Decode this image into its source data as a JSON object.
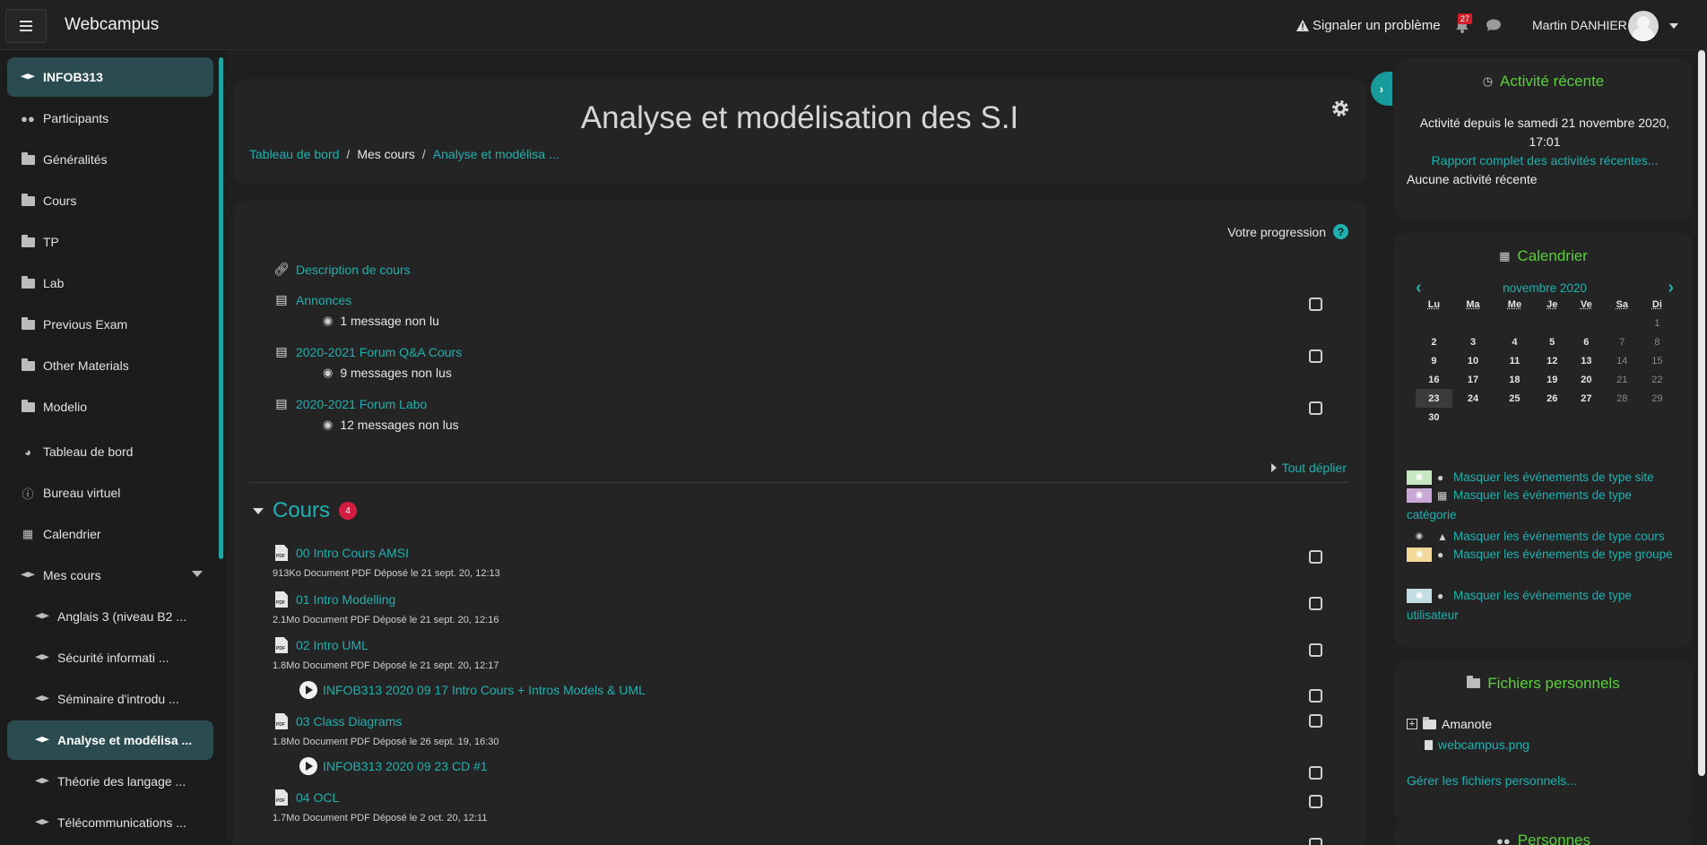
{
  "navbar": {
    "brand": "Webcampus",
    "report": "Signaler un problème",
    "notif_count": "27",
    "user_name": "Martin DANHIER"
  },
  "drawer": {
    "items": [
      {
        "label": "INFOB313",
        "icon": "graduation-cap-icon",
        "active": true
      },
      {
        "label": "Participants",
        "icon": "users-icon"
      },
      {
        "label": "Généralités",
        "icon": "folder-icon"
      },
      {
        "label": "Cours",
        "icon": "folder-icon"
      },
      {
        "label": "TP",
        "icon": "folder-icon"
      },
      {
        "label": "Lab",
        "icon": "folder-icon"
      },
      {
        "label": "Previous Exam",
        "icon": "folder-icon"
      },
      {
        "label": "Other Materials",
        "icon": "folder-icon"
      },
      {
        "label": "Modelio",
        "icon": "folder-icon"
      },
      {
        "label": "Tableau de bord",
        "icon": "dashboard-icon"
      },
      {
        "label": "Bureau virtuel",
        "icon": "info-icon"
      },
      {
        "label": "Calendrier",
        "icon": "calendar-icon"
      },
      {
        "label": "Mes cours",
        "icon": "graduation-cap-icon"
      },
      {
        "label": "Anglais 3 (niveau B2 ...",
        "icon": "graduation-cap-icon"
      },
      {
        "label": "Sécurité informati ...",
        "icon": "graduation-cap-icon"
      },
      {
        "label": "Séminaire d'introdu ...",
        "icon": "graduation-cap-icon"
      },
      {
        "label": "Analyse et modélisa ...",
        "icon": "graduation-cap-icon",
        "active": true
      },
      {
        "label": "Théorie des langage ...",
        "icon": "graduation-cap-icon"
      },
      {
        "label": "Télécommunications ...",
        "icon": "graduation-cap-icon"
      }
    ]
  },
  "header": {
    "title": "Analyse et modélisation des S.I",
    "breadcrumb": [
      "Tableau de bord",
      "Mes cours",
      "Analyse et modélisa ..."
    ]
  },
  "course": {
    "progress_label": "Votre progression",
    "progress_help": "?",
    "top_activities": [
      {
        "label": "Description de cours",
        "icon": "link-icon"
      },
      {
        "label": "Annonces",
        "icon": "forum-icon",
        "unread": "1 message non lu"
      },
      {
        "label": "2020-2021 Forum Q&A Cours",
        "icon": "forum-icon",
        "unread": "9 messages non lus"
      },
      {
        "label": "2020-2021 Forum Labo",
        "icon": "forum-icon",
        "unread": "12 messages non lus"
      }
    ],
    "expand_all": "Tout déplier",
    "section_title": "Cours",
    "section_count": "4",
    "section_activities": [
      {
        "label": "00 Intro Cours AMSI",
        "type": "pdf",
        "meta": "913Ko Document PDF Déposé le 21 sept. 20, 12:13"
      },
      {
        "label": "01 Intro Modelling",
        "type": "pdf",
        "meta": "2.1Mo Document PDF Déposé le 21 sept. 20, 12:16"
      },
      {
        "label": "02 Intro UML",
        "type": "pdf",
        "meta": "1.8Mo Document PDF Déposé le 21 sept. 20, 12:17"
      },
      {
        "label": "INFOB313 2020 09 17 Intro Cours + Intros Models & UML",
        "type": "video"
      },
      {
        "label": "03 Class Diagrams",
        "type": "pdf",
        "meta": "1.8Mo Document PDF Déposé le 26 sept. 19, 16:30"
      },
      {
        "label": "INFOB313 2020 09 23 CD #1",
        "type": "video"
      },
      {
        "label": "04 OCL",
        "type": "pdf",
        "meta": "1.7Mo Document PDF Déposé le 2 oct. 20, 12:11"
      }
    ]
  },
  "recent": {
    "title": "Activité récente",
    "since": "Activité depuis le samedi 21 novembre 2020, 17:01",
    "report_link": "Rapport complet des activités récentes...",
    "none": "Aucune activité récente"
  },
  "calendar": {
    "title": "Calendrier",
    "month": "novembre 2020",
    "days": [
      "Lu",
      "Ma",
      "Me",
      "Je",
      "Ve",
      "Sa",
      "Di"
    ],
    "weeks": [
      [
        "",
        "",
        "",
        "",
        "",
        "",
        "1"
      ],
      [
        "2",
        "3",
        "4",
        "5",
        "6",
        "7",
        "8"
      ],
      [
        "9",
        "10",
        "11",
        "12",
        "13",
        "14",
        "15"
      ],
      [
        "16",
        "17",
        "18",
        "19",
        "20",
        "21",
        "22"
      ],
      [
        "23",
        "24",
        "25",
        "26",
        "27",
        "28",
        "29"
      ],
      [
        "30",
        "",
        "",
        "",
        "",
        "",
        ""
      ]
    ],
    "today": "23",
    "filters": [
      {
        "label": "Masquer les événements de type site",
        "swatch": "#c7e6c2",
        "icon": "globe-icon"
      },
      {
        "label": "Masquer les événements de type catégorie",
        "swatch": "#c9a8d6",
        "icon": "cubes-icon"
      },
      {
        "label": "Masquer les événements de type cours",
        "swatch": "",
        "icon": "university-icon"
      },
      {
        "label": "Masquer les événements de type groupe",
        "swatch": "#f3d99c",
        "icon": "users-icon"
      },
      {
        "label": "Masquer les événements de type utilisateur",
        "swatch": "#c3dce6",
        "icon": "user-icon"
      }
    ]
  },
  "files": {
    "title": "Fichiers personnels",
    "folder": "Amanote",
    "file": "webcampus.png",
    "manage": "Gérer les fichiers personnels..."
  },
  "next_block_title": "Personnes"
}
